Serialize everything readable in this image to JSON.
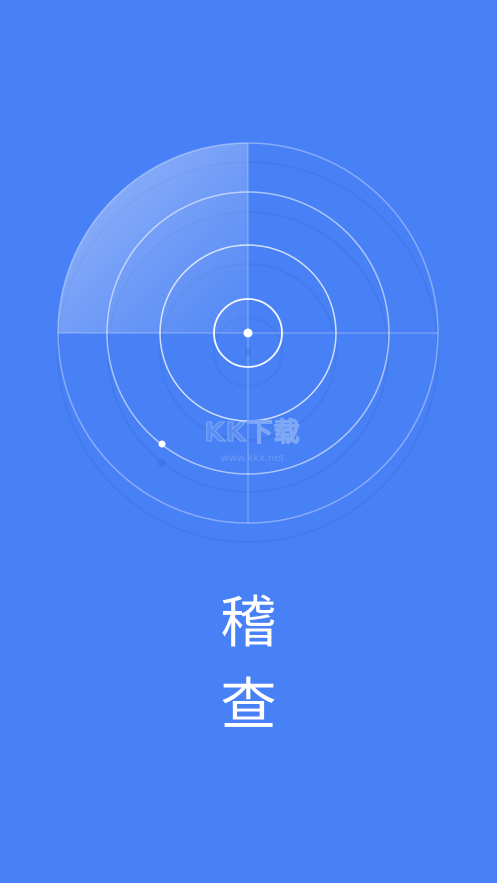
{
  "app": {
    "title_line_1": "稽",
    "title_line_2": "查"
  },
  "watermark": {
    "main": "KK下载",
    "sub": "www.kkx.net"
  },
  "colors": {
    "background": "#4880f5",
    "ring": "#ffffff",
    "text": "#ffffff"
  },
  "icons": {
    "radar": "radar-icon",
    "center_dot": "center-dot-icon",
    "blip": "blip-icon"
  }
}
